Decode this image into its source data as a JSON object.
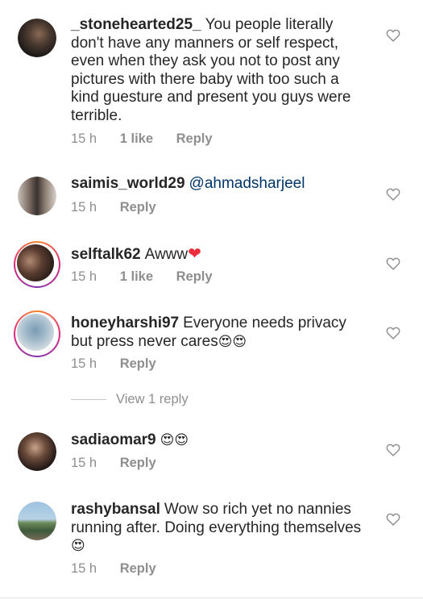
{
  "comments": [
    {
      "username": "_stonehearted25_",
      "text": "You people literally don't have any manners or self respect, even when they ask you not to post any pictures with there baby with too such a kind guesture and present you guys were terrible.",
      "time": "15 h",
      "likes": "1 like",
      "reply": "Reply",
      "story_ring": false
    },
    {
      "username": "saimis_world29",
      "mention": "@ahmadsharjeel",
      "time": "15 h",
      "reply": "Reply",
      "story_ring": false
    },
    {
      "username": "selftalk62",
      "text": "Awww",
      "emoji": "❤",
      "time": "15 h",
      "likes": "1 like",
      "reply": "Reply",
      "story_ring": true
    },
    {
      "username": "honeyharshi97",
      "text": "Everyone needs privacy but press never cares",
      "emoji": "😍😍",
      "time": "15 h",
      "reply": "Reply",
      "story_ring": true
    },
    {
      "username": "sadiaomar9",
      "emoji": "😍😍",
      "time": "15 h",
      "reply": "Reply",
      "story_ring": false
    },
    {
      "username": "rashybansal",
      "text": "Wow so rich yet no nannies running after. Doing everything themselves",
      "emoji": "😍",
      "time": "15 h",
      "reply": "Reply",
      "story_ring": false
    }
  ],
  "view_replies": "View 1 reply",
  "icons": {
    "like": "heart-outline-icon"
  },
  "colors": {
    "text": "#262626",
    "meta": "#8e8e8e",
    "mention": "#003569",
    "heart": "#ed2b3b"
  }
}
